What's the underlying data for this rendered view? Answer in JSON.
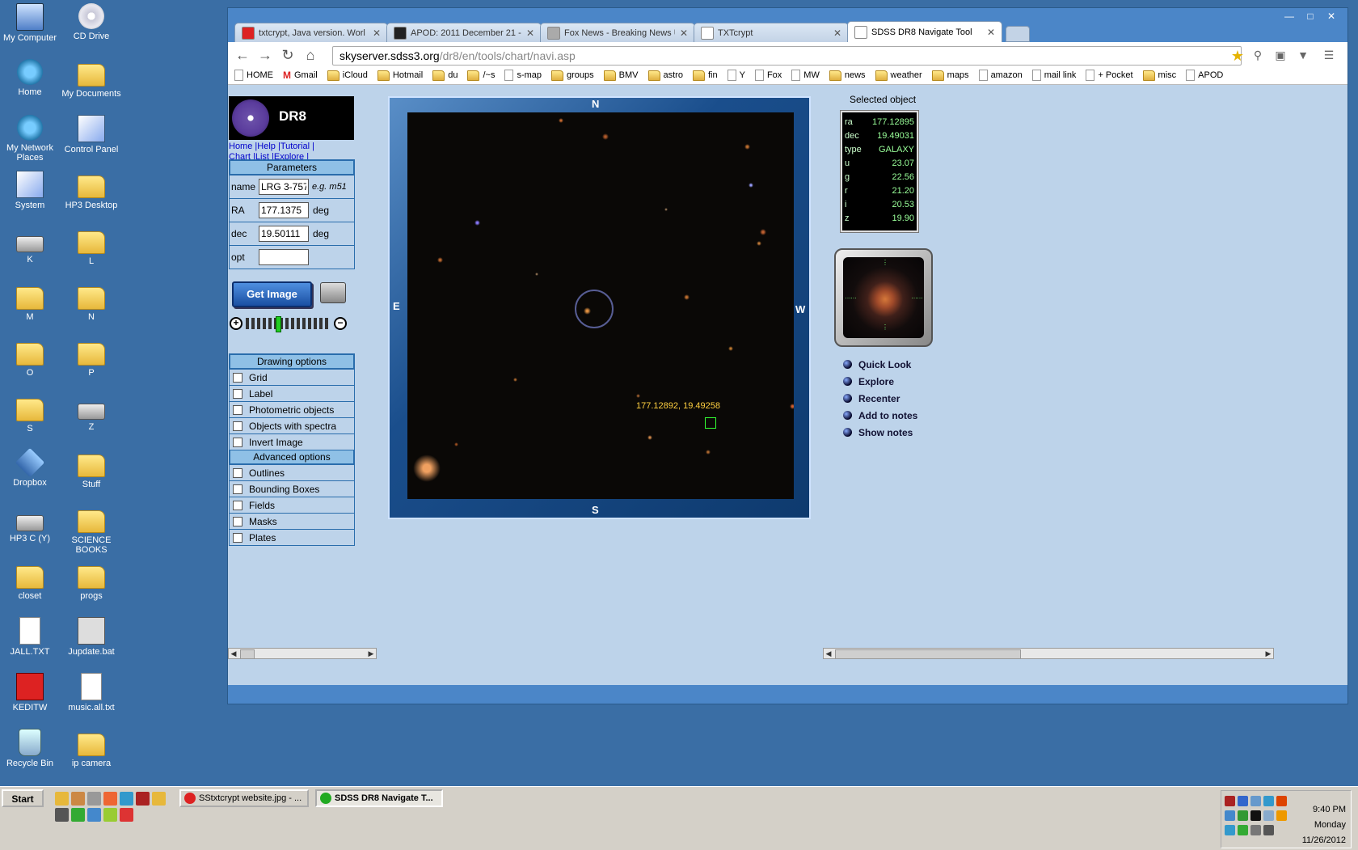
{
  "desktop": {
    "icons": [
      {
        "label": "My Computer",
        "kind": "pc"
      },
      {
        "label": "CD Drive",
        "kind": "cd"
      },
      {
        "label": "Home",
        "kind": "net"
      },
      {
        "label": "My Documents",
        "kind": "folder"
      },
      {
        "label": "My Network Places",
        "kind": "net"
      },
      {
        "label": "Control Panel",
        "kind": "cp"
      },
      {
        "label": "System",
        "kind": "cp"
      },
      {
        "label": "HP3 Desktop",
        "kind": "folder"
      },
      {
        "label": "K",
        "kind": "drive"
      },
      {
        "label": "L",
        "kind": "folder"
      },
      {
        "label": "M",
        "kind": "folder"
      },
      {
        "label": "N",
        "kind": "folder"
      },
      {
        "label": "O",
        "kind": "folder"
      },
      {
        "label": "P",
        "kind": "folder"
      },
      {
        "label": "S",
        "kind": "folder"
      },
      {
        "label": "Z",
        "kind": "drive"
      },
      {
        "label": "Dropbox",
        "kind": "drop"
      },
      {
        "label": "Stuff",
        "kind": "folder"
      },
      {
        "label": "HP3 C (Y)",
        "kind": "drive"
      },
      {
        "label": "SCIENCE BOOKS",
        "kind": "folder"
      },
      {
        "label": "closet",
        "kind": "folder"
      },
      {
        "label": "progs",
        "kind": "folder"
      },
      {
        "label": "JALL.TXT",
        "kind": "file"
      },
      {
        "label": "Jupdate.bat",
        "kind": "bat"
      },
      {
        "label": "KEDITW",
        "kind": "kedit"
      },
      {
        "label": "music.all.txt",
        "kind": "file"
      },
      {
        "label": "Recycle Bin",
        "kind": "bin"
      },
      {
        "label": "ip camera",
        "kind": "folder"
      }
    ]
  },
  "browser": {
    "tabs": [
      {
        "label": "txtcrypt, Java version. Worl",
        "icon_color": "#d22"
      },
      {
        "label": "APOD: 2011 December 21 - /",
        "icon_color": "#222"
      },
      {
        "label": "Fox News - Breaking News U",
        "icon_color": "#aaa"
      },
      {
        "label": "TXTcrypt",
        "icon_color": "#fff"
      },
      {
        "label": "SDSS DR8 Navigate Tool",
        "icon_color": "#fff"
      }
    ],
    "url_host": "skyserver.sdss3.org",
    "url_path": "/dr8/en/tools/chart/navi.asp",
    "bookmarks": [
      {
        "label": "HOME",
        "icon": "page"
      },
      {
        "label": "Gmail",
        "icon": "mail"
      },
      {
        "label": "iCloud",
        "icon": "fold"
      },
      {
        "label": "Hotmail",
        "icon": "fold"
      },
      {
        "label": "du",
        "icon": "fold"
      },
      {
        "label": "/~s",
        "icon": "fold"
      },
      {
        "label": "s-map",
        "icon": "page"
      },
      {
        "label": "groups",
        "icon": "fold"
      },
      {
        "label": "BMV",
        "icon": "fold"
      },
      {
        "label": "astro",
        "icon": "fold"
      },
      {
        "label": "fin",
        "icon": "fold"
      },
      {
        "label": "Y",
        "icon": "page"
      },
      {
        "label": "Fox",
        "icon": "page"
      },
      {
        "label": "MW",
        "icon": "page"
      },
      {
        "label": "news",
        "icon": "fold"
      },
      {
        "label": "weather",
        "icon": "fold"
      },
      {
        "label": "maps",
        "icon": "fold"
      },
      {
        "label": "amazon",
        "icon": "page"
      },
      {
        "label": "mail link",
        "icon": "page"
      },
      {
        "label": "+ Pocket",
        "icon": "page"
      },
      {
        "label": "misc",
        "icon": "fold"
      },
      {
        "label": "APOD",
        "icon": "page"
      }
    ]
  },
  "page": {
    "logo_text": "DR8",
    "toplinks": [
      "Home",
      "Help",
      "Tutorial",
      "Chart",
      "List",
      "Explore"
    ],
    "params_title": "Parameters",
    "params": {
      "name_label": "name",
      "name_value": "LRG 3-757",
      "name_hint": "e.g. m51",
      "ra_label": "RA",
      "ra_value": "177.1375",
      "ra_unit": "deg",
      "dec_label": "dec",
      "dec_value": "19.50111",
      "dec_unit": "deg",
      "opt_label": "opt",
      "opt_value": ""
    },
    "get_image_label": "Get Image",
    "zoom_level": 0.35,
    "drawing_title": "Drawing options",
    "drawing_options": [
      "Grid",
      "Label",
      "Photometric objects",
      "Objects with spectra",
      "Invert Image"
    ],
    "advanced_title": "Advanced options",
    "advanced_options": [
      "Outlines",
      "Bounding Boxes",
      "Fields",
      "Masks",
      "Plates"
    ],
    "compass": {
      "n": "N",
      "s": "S",
      "e": "E",
      "w": "W"
    },
    "cursor_coords": "177.12892, 19.49258",
    "selected_title": "Selected object",
    "selected": [
      {
        "k": "ra",
        "v": "177.12895"
      },
      {
        "k": "dec",
        "v": "19.49031"
      },
      {
        "k": "type",
        "v": "GALAXY"
      },
      {
        "k": "u",
        "v": "23.07"
      },
      {
        "k": "g",
        "v": "22.56"
      },
      {
        "k": "r",
        "v": "21.20"
      },
      {
        "k": "i",
        "v": "20.53"
      },
      {
        "k": "z",
        "v": "19.90"
      }
    ],
    "actions": [
      "Quick Look",
      "Explore",
      "Recenter",
      "Add to notes",
      "Show notes"
    ]
  },
  "taskbar": {
    "start_label": "Start",
    "tasks": [
      {
        "label": "SStxtcrypt website.jpg - ...",
        "pressed": false,
        "icon_color": "#d22"
      },
      {
        "label": "SDSS DR8 Navigate T...",
        "pressed": true,
        "icon_color": "#2a2"
      }
    ],
    "time": "9:40 PM",
    "day": "Monday",
    "date": "11/26/2012"
  }
}
